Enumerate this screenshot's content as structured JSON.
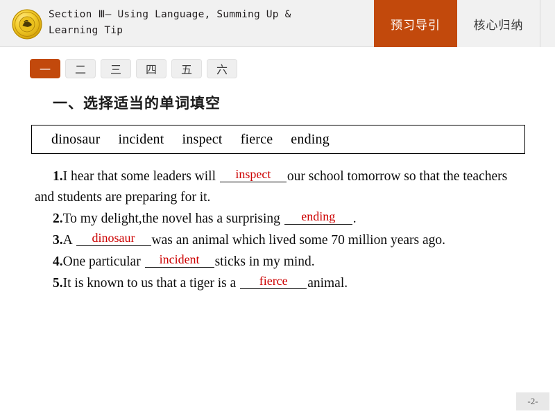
{
  "header": {
    "logo_icon": "gold-medallion-icon",
    "title": "Section Ⅲ— Using Language, Summing Up &\n        Learning Tip",
    "tabs": [
      {
        "label": "预习导引",
        "active": true
      },
      {
        "label": "核心归纳",
        "active": false
      }
    ],
    "accent_color": "#c2490c",
    "background_color": "#f1f1f1"
  },
  "numeral_tabs": [
    {
      "label": "一",
      "active": true
    },
    {
      "label": "二",
      "active": false
    },
    {
      "label": "三",
      "active": false
    },
    {
      "label": "四",
      "active": false
    },
    {
      "label": "五",
      "active": false
    },
    {
      "label": "六",
      "active": false
    }
  ],
  "main": {
    "section_heading": "一、选择适当的单词填空",
    "word_bank": [
      "dinosaur",
      "incident",
      "inspect",
      "fierce",
      "ending"
    ],
    "answer_color": "#cc0000",
    "questions": [
      {
        "number": "1.",
        "before": "I hear that some leaders will ",
        "answer": "inspect",
        "after": "our school tomorrow so that the teachers and students are preparing for it."
      },
      {
        "number": "2.",
        "before": "To my delight,the novel has a surprising ",
        "answer": "ending",
        "after": "."
      },
      {
        "number": "3.",
        "before": "A ",
        "answer": "dinosaur",
        "after": "was an animal which lived some 70 million years ago."
      },
      {
        "number": "4.",
        "before": "One particular ",
        "answer": "incident",
        "after": "sticks in my mind."
      },
      {
        "number": "5.",
        "before": "It is known to us that a tiger is a ",
        "answer": "fierce",
        "after": "animal."
      }
    ]
  },
  "footer": {
    "page_number": "-2-"
  }
}
